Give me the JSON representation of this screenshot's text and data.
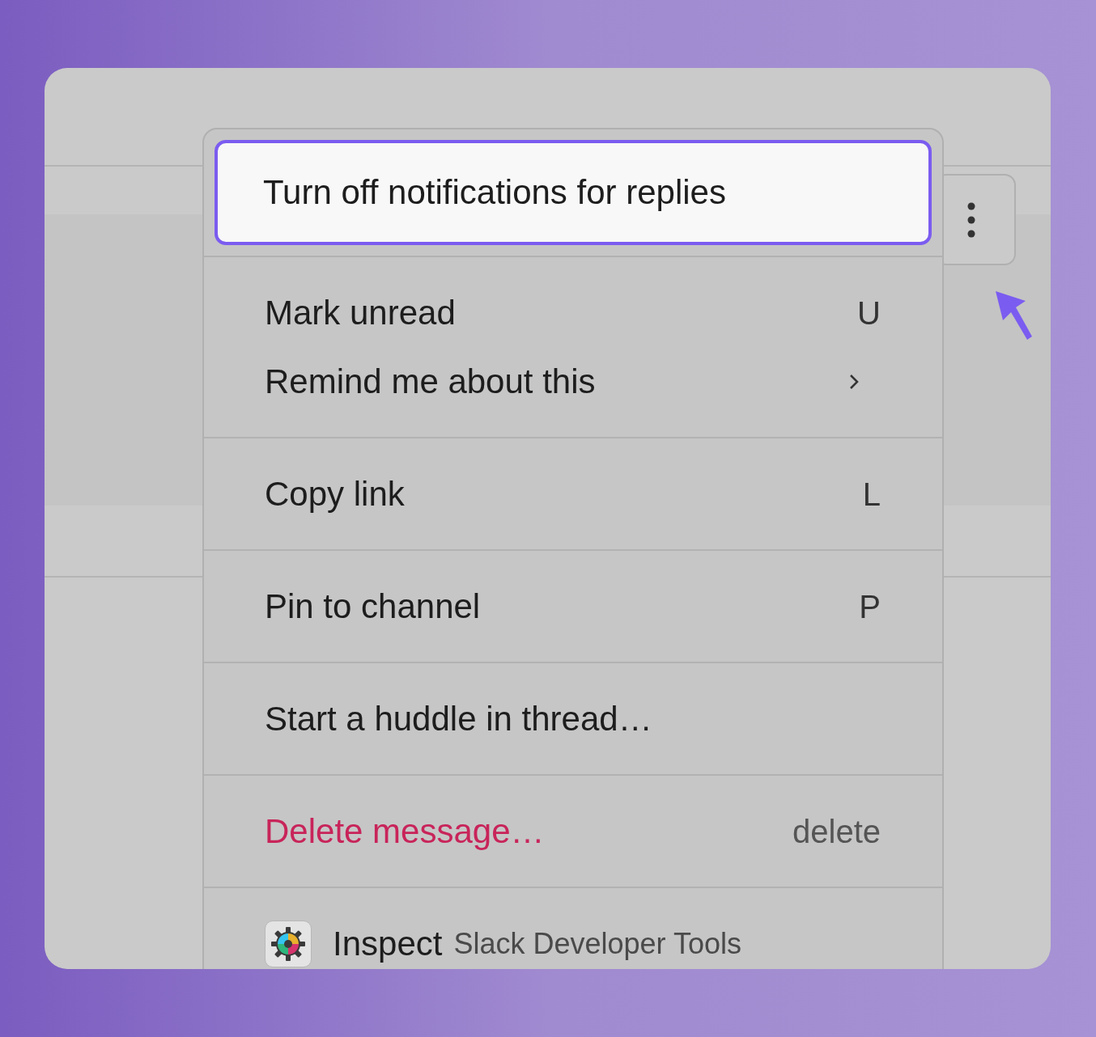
{
  "menu": {
    "sections": [
      {
        "items": [
          {
            "kind": "normal",
            "label": "Turn off notifications for replies",
            "selected": true
          }
        ]
      },
      {
        "items": [
          {
            "kind": "normal",
            "label": "Mark unread",
            "shortcut": "U",
            "selected": false
          },
          {
            "kind": "submenu",
            "label": "Remind me about this",
            "selected": false
          }
        ]
      },
      {
        "items": [
          {
            "kind": "normal",
            "label": "Copy link",
            "shortcut": "L",
            "selected": false
          }
        ]
      },
      {
        "items": [
          {
            "kind": "normal",
            "label": "Pin to channel",
            "shortcut": "P",
            "selected": false
          }
        ]
      },
      {
        "items": [
          {
            "kind": "normal",
            "label": "Start a huddle in thread…",
            "selected": false
          }
        ]
      },
      {
        "items": [
          {
            "kind": "danger",
            "label": "Delete message…",
            "shortcut": "delete",
            "selected": false
          }
        ]
      },
      {
        "items": [
          {
            "kind": "inspect",
            "label": "Inspect",
            "detail": "Slack Developer Tools",
            "selected": false
          }
        ]
      }
    ]
  }
}
